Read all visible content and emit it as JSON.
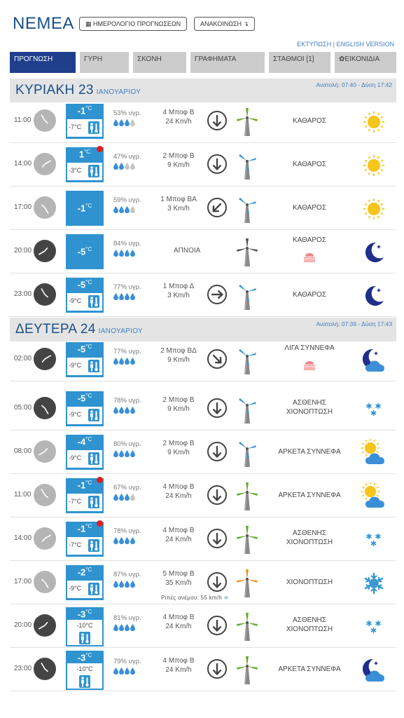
{
  "header": {
    "title": "ΝΕΜΕΑ",
    "calendar_btn": "ΗΜΕΡΟΛΟΓΙΟ ΠΡΟΓΝΩΣΕΩΝ",
    "announce_btn": "ΑΝΑΚΟΙΝΩΣΗ",
    "print_link": "ΕΚΤΥΠΩΣΗ",
    "sep": "|",
    "english_link": "ENGLISH VERSION"
  },
  "tabs": [
    {
      "label": "ΠΡΟΓΝΩΣΗ"
    },
    {
      "label": "ΓΥΡΗ"
    },
    {
      "label": "ΣΚΟΝΗ"
    },
    {
      "label": "ΓΡΑΦΗΜΑΤΑ"
    },
    {
      "label": "ΣΤΑΘΜΟΙ [1]"
    },
    {
      "label": "ΕΙΚΟΝΙΔΙΑ"
    }
  ],
  "days": [
    {
      "name": "ΚΥΡΙΑΚΗ 23",
      "month": "ΙΑΝΟΥΑΡΙΟΥ",
      "sun": "Ανατολή: 07:40 - Δύση 17:42"
    },
    {
      "name": "ΔΕΥΤΕΡΑ 24",
      "month": "ΙΑΝΟΥΑΡΙΟΥ",
      "sun": "Ανατολή: 07:39 - Δύση 17:43"
    }
  ],
  "colors": {
    "brand": "#1a4f8a",
    "tab_active": "#1f3f8c",
    "temp_box": "#2f93d0",
    "drop_full": "#3a8fd6",
    "drop_empty": "#c5c5c5",
    "alert": "#e0201c"
  },
  "rows": [
    {
      "time": "11:00",
      "clock": "light",
      "hand_angle": 330,
      "tmax": "-1",
      "tmin": "-7°C",
      "box": "double",
      "alert": false,
      "hum": "53% υγρ.",
      "drops": 3,
      "wind1": "4 Μποφ Β",
      "wind2": "24 Km/h",
      "arrow_deg": 0,
      "turbine": "green",
      "turbine_speed": "fast",
      "cond": [
        "ΚΑΘΑΡΟΣ"
      ],
      "icon": "sun"
    },
    {
      "time": "14:00",
      "clock": "light",
      "hand_angle": 60,
      "tmax": "1",
      "tmin": "-3°C",
      "box": "double",
      "alert": true,
      "hum": "47% υγρ.",
      "drops": 2,
      "wind1": "2 Μποφ Β",
      "wind2": "9 Km/h",
      "arrow_deg": 0,
      "turbine": "blue",
      "turbine_speed": "slow",
      "cond": [
        "ΚΑΘΑΡΟΣ"
      ],
      "icon": "sun"
    },
    {
      "time": "17:00",
      "clock": "light",
      "hand_angle": 150,
      "tmax": "-1",
      "tmin": "",
      "box": "single",
      "alert": false,
      "hum": "59% υγρ.",
      "drops": 3,
      "wind1": "1 Μποφ ΒΑ",
      "wind2": "3 Km/h",
      "arrow_deg": 45,
      "turbine": "blue",
      "turbine_speed": "slow",
      "cond": [
        "ΚΑΘΑΡΟΣ"
      ],
      "icon": "sun"
    },
    {
      "time": "20:00",
      "clock": "dark",
      "hand_angle": 240,
      "tmax": "-5",
      "tmin": "",
      "box": "single",
      "alert": false,
      "hum": "84% υγρ.",
      "drops": 4,
      "calm": "ΑΠΝΟΙΑ",
      "turbine": "gray",
      "turbine_speed": "none",
      "cond": [
        "ΚΑΘΑΡΟΣ"
      ],
      "fog": true,
      "icon": "moon"
    },
    {
      "time": "23:00",
      "clock": "dark",
      "hand_angle": 330,
      "tmax": "-5",
      "tmin": "-9°C",
      "box": "double",
      "alert": false,
      "hum": "77% υγρ.",
      "drops": 4,
      "wind1": "1 Μποφ Δ",
      "wind2": "3 Km/h",
      "arrow_deg": 270,
      "turbine": "blue",
      "turbine_speed": "slow",
      "cond": [
        "ΚΑΘΑΡΟΣ"
      ],
      "icon": "moon"
    },
    {
      "time": "02:00",
      "clock": "dark",
      "hand_angle": 60,
      "tmax": "-5",
      "tmin": "-9°C",
      "box": "double",
      "alert": false,
      "hum": "77% υγρ.",
      "drops": 4,
      "wind1": "2 Μποφ ΒΔ",
      "wind2": "9 Km/h",
      "arrow_deg": 315,
      "turbine": "blue",
      "turbine_speed": "slow",
      "cond": [
        "ΛΙΓΑ ΣΥΝΝΕΦΑ"
      ],
      "fog": true,
      "icon": "moon-cloud"
    },
    {
      "time": "05:00",
      "clock": "dark",
      "hand_angle": 150,
      "tmax": "-5",
      "tmin": "-9°C",
      "box": "double",
      "alert": false,
      "hum": "78% υγρ.",
      "drops": 4,
      "wind1": "2 Μποφ Β",
      "wind2": "9 Km/h",
      "arrow_deg": 0,
      "turbine": "blue",
      "turbine_speed": "slow",
      "cond": [
        "ΑΣΘΕΝΗΣ",
        "ΧΙΟΝΟΠΤΩΣΗ"
      ],
      "icon": "snow-light"
    },
    {
      "time": "08:00",
      "clock": "light",
      "hand_angle": 240,
      "tmax": "-4",
      "tmin": "-9°C",
      "box": "double",
      "alert": false,
      "hum": "80% υγρ.",
      "drops": 4,
      "wind1": "2 Μποφ Β",
      "wind2": "9 Km/h",
      "arrow_deg": 0,
      "turbine": "blue",
      "turbine_speed": "slow",
      "cond": [
        "ΑΡΚΕΤΑ ΣΥΝΝΕΦΑ"
      ],
      "icon": "sun-cloud"
    },
    {
      "time": "11:00",
      "clock": "light",
      "hand_angle": 330,
      "tmax": "-1",
      "tmin": "-7°C",
      "box": "double",
      "alert": true,
      "hum": "67% υγρ.",
      "drops": 3,
      "wind1": "4 Μποφ Β",
      "wind2": "24 Km/h",
      "arrow_deg": 0,
      "turbine": "green",
      "turbine_speed": "fast",
      "cond": [
        "ΑΡΚΕΤΑ ΣΥΝΝΕΦΑ"
      ],
      "icon": "sun-cloud"
    },
    {
      "time": "14:00",
      "clock": "light",
      "hand_angle": 60,
      "tmax": "-1",
      "tmin": "-7°C",
      "box": "double",
      "alert": true,
      "hum": "78% υγρ.",
      "drops": 4,
      "wind1": "4 Μποφ Β",
      "wind2": "24 Km/h",
      "arrow_deg": 0,
      "turbine": "green",
      "turbine_speed": "fast",
      "cond": [
        "ΑΣΘΕΝΗΣ",
        "ΧΙΟΝΟΠΤΩΣΗ"
      ],
      "icon": "snow-light"
    },
    {
      "time": "17:00",
      "clock": "light",
      "hand_angle": 150,
      "tmax": "-2",
      "tmin": "-9°C",
      "box": "double",
      "alert": false,
      "hum": "87% υγρ.",
      "drops": 4,
      "wind1": "5 Μποφ Β",
      "wind2": "35 Km/h",
      "arrow_deg": 0,
      "turbine": "orange",
      "turbine_speed": "fast",
      "gust": "Ριπές ανέμου: 55 km/h",
      "cond": [
        "ΧΙΟΝΟΠΤΩΣΗ"
      ],
      "icon": "snowflake"
    },
    {
      "time": "20:00",
      "clock": "dark",
      "hand_angle": 240,
      "tmax": "-3",
      "tmin": "-10°C",
      "box": "tall",
      "alert": false,
      "hum": "81% υγρ.",
      "drops": 4,
      "wind1": "4 Μποφ Β",
      "wind2": "24 Km/h",
      "arrow_deg": 0,
      "turbine": "green",
      "turbine_speed": "fast",
      "cond": [
        "ΑΣΘΕΝΗΣ",
        "ΧΙΟΝΟΠΤΩΣΗ"
      ],
      "icon": "snow-light"
    },
    {
      "time": "23:00",
      "clock": "dark",
      "hand_angle": 330,
      "tmax": "-3",
      "tmin": "-10°C",
      "box": "tall",
      "alert": false,
      "hum": "79% υγρ.",
      "drops": 4,
      "wind1": "4 Μποφ Β",
      "wind2": "24 Km/h",
      "arrow_deg": 0,
      "turbine": "green",
      "turbine_speed": "fast",
      "cond": [
        "ΑΡΚΕΤΑ ΣΥΝΝΕΦΑ"
      ],
      "icon": "moon-cloud"
    }
  ]
}
